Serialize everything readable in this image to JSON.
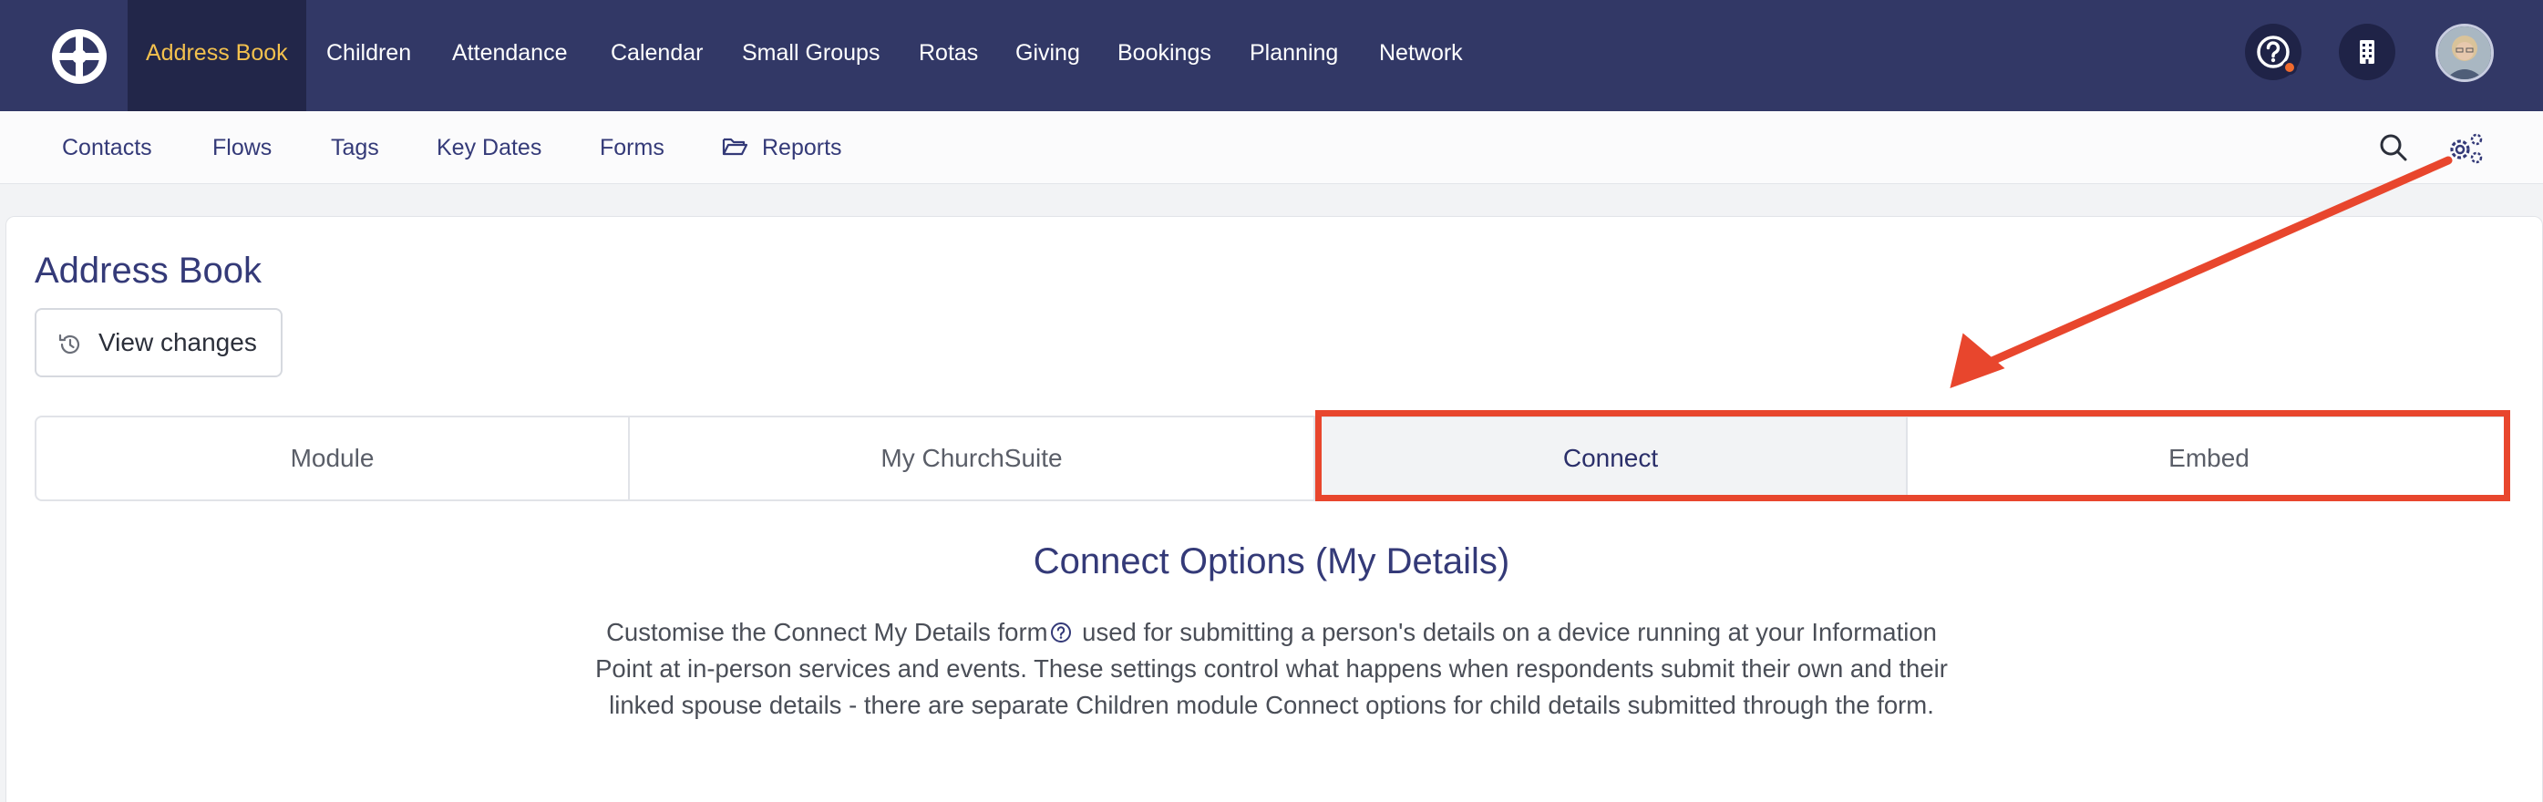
{
  "topnav": {
    "items": [
      {
        "label": "Address Book",
        "active": true
      },
      {
        "label": "Children"
      },
      {
        "label": "Attendance"
      },
      {
        "label": "Calendar"
      },
      {
        "label": "Small Groups"
      },
      {
        "label": "Rotas"
      },
      {
        "label": "Giving"
      },
      {
        "label": "Bookings"
      },
      {
        "label": "Planning"
      },
      {
        "label": "Network"
      }
    ],
    "icons": [
      "help-icon",
      "building-icon",
      "avatar"
    ],
    "colors": {
      "background": "#323866",
      "active_background": "#222649",
      "active_text": "#f3c14e"
    }
  },
  "subnav": {
    "items": [
      {
        "label": "Contacts"
      },
      {
        "label": "Flows"
      },
      {
        "label": "Tags"
      },
      {
        "label": "Key Dates"
      },
      {
        "label": "Forms"
      },
      {
        "label": "Reports",
        "icon": "folder-open-icon"
      }
    ],
    "right_icons": [
      "search-icon",
      "settings-gears-icon"
    ]
  },
  "page": {
    "title": "Address Book",
    "view_changes_label": "View changes"
  },
  "tabs": [
    {
      "label": "Module"
    },
    {
      "label": "My ChurchSuite"
    },
    {
      "label": "Connect",
      "active": true
    },
    {
      "label": "Embed"
    }
  ],
  "section": {
    "title": "Connect Options (My Details)",
    "desc_part1": "Customise the Connect My Details form",
    "desc_part2": " used for submitting a person's details on a device running at your Information Point at in-person services and events. These settings control what happens when respondents submit their own and their linked spouse details - there are separate Children module Connect options for child details submitted through the form."
  },
  "annotation": {
    "color": "#e8462d"
  }
}
